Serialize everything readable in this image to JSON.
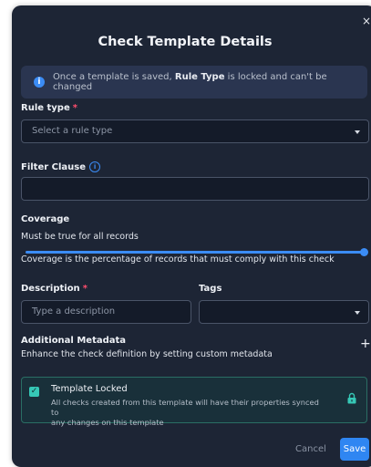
{
  "dialog": {
    "title": "Check Template Details",
    "close_symbol": "×",
    "banner": {
      "icon": "info-icon",
      "text_before": "Once a template is saved, ",
      "text_bold": "Rule Type",
      "text_after": " is locked and can't be changed"
    },
    "rule_type": {
      "label": "Rule type",
      "required_mark": "*",
      "placeholder": "Select a rule type"
    },
    "filter_clause": {
      "label": "Filter Clause",
      "value": ""
    },
    "coverage": {
      "label": "Coverage",
      "value_text": "Must be true for all records",
      "value_fraction": 1.0,
      "help": "Coverage is the percentage of records that must comply with this check"
    },
    "description": {
      "label": "Description",
      "required_mark": "*",
      "placeholder": "Type a description"
    },
    "tags": {
      "label": "Tags",
      "value": ""
    },
    "metadata": {
      "label": "Additional Metadata",
      "help": "Enhance the check definition by setting custom metadata",
      "add_symbol": "+"
    },
    "template_locked": {
      "checked": true,
      "title": "Template Locked",
      "description_line1": "All checks created from this template will have their properties synced to",
      "description_line2": "any changes on this template"
    },
    "buttons": {
      "cancel": "Cancel",
      "save": "Save"
    },
    "colors": {
      "accent": "#3b8cf5",
      "save": "#2f86f2",
      "teal": "#36c8b6",
      "required": "#ff4d6d"
    }
  }
}
